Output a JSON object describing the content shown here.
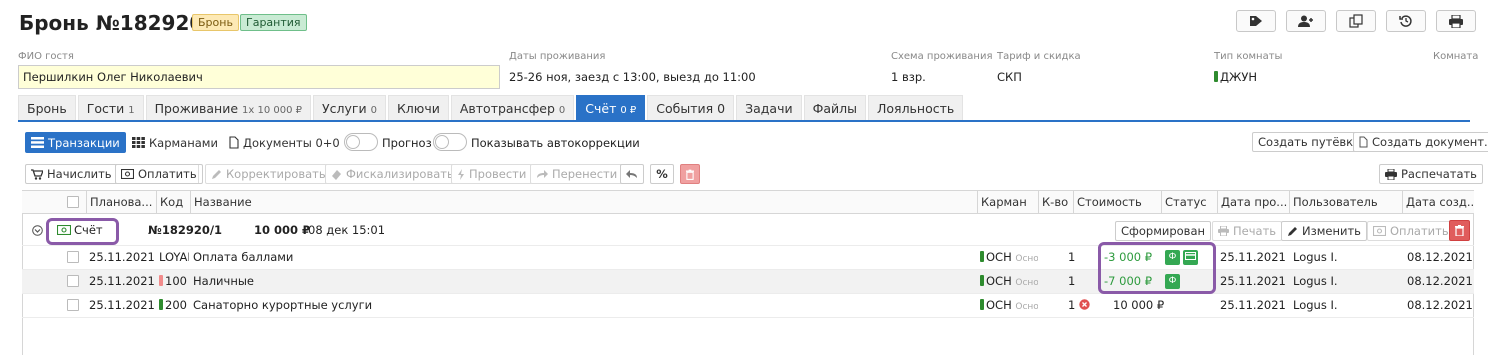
{
  "header": {
    "title": "Бронь №182920",
    "badge_status": "Бронь",
    "badge_guarantee": "Гарантия",
    "toolbar_icons": [
      "tag-icon",
      "add-user-icon",
      "copy-icon",
      "history-icon",
      "print-icon"
    ]
  },
  "info": {
    "guest_label": "ФИО гостя",
    "guest_value": "Першилкин Олег Николаевич",
    "dates_label": "Даты проживания",
    "dates_value": "25-26 ноя, заезд с 13:00, выезд до 11:00",
    "scheme_label": "Схема проживания",
    "scheme_value": "1 взр.",
    "tariff_label": "Тариф и скидка",
    "tariff_value": "СКП",
    "room_type_label": "Тип комнаты",
    "room_type_value": "ДЖУН",
    "room_label": "Комната"
  },
  "tabs": [
    {
      "label": "Бронь",
      "sub": ""
    },
    {
      "label": "Гости",
      "sub": "1"
    },
    {
      "label": "Проживание",
      "sub": "1x 10 000 ₽"
    },
    {
      "label": "Услуги",
      "sub": "0"
    },
    {
      "label": "Ключи",
      "sub": ""
    },
    {
      "label": "Автотрансфер",
      "sub": "0"
    },
    {
      "label": "Счёт",
      "sub": "0 ₽"
    },
    {
      "label": "События 0",
      "sub": ""
    },
    {
      "label": "Задачи",
      "sub": ""
    },
    {
      "label": "Файлы",
      "sub": ""
    },
    {
      "label": "Лояльность",
      "sub": ""
    }
  ],
  "view": {
    "transactions": "Транзакции",
    "pockets": "Карманами",
    "documents": "Документы 0+0",
    "forecast": "Прогноз",
    "autocorrections": "Показывать автокоррекции",
    "create_voucher": "Создать путёвки",
    "create_document": "Создать документ..."
  },
  "actions": {
    "charge": "Начислить",
    "pay": "Оплатить",
    "correct": "Корректировать",
    "fiscalize": "Фискализировать",
    "post": "Провести",
    "transfer": "Перенести",
    "percent": "%",
    "print": "Распечатать"
  },
  "columns": {
    "planned": "Планова...",
    "code": "Код",
    "name": "Название",
    "pocket": "Карман",
    "qty": "К-во",
    "cost": "Стоимость",
    "status": "Статус",
    "date_posted": "Дата про...",
    "user": "Пользователь",
    "date_created": "Дата созд..."
  },
  "invoice": {
    "label": "Счёт",
    "number": "№182920/1",
    "amount": "10 000 ₽",
    "date": "08 дек 15:01",
    "formed": "Сформирован",
    "print": "Печать",
    "edit": "Изменить",
    "pay": "Оплатить"
  },
  "rows": [
    {
      "planned": "25.11.2021",
      "code": "LOYAL",
      "name": "Оплата баллами",
      "pocket": "ОСН",
      "pocket_sub": "Осно",
      "qty": "1",
      "cost": "-3 000 ₽",
      "date_posted": "25.11.2021",
      "user": "Logus I.",
      "date_created": "08.12.2021"
    },
    {
      "planned": "25.11.2021",
      "code": "100",
      "name": "Наличные",
      "pocket": "ОСН",
      "pocket_sub": "Осно",
      "qty": "1",
      "cost": "-7 000 ₽",
      "date_posted": "25.11.2021",
      "user": "Logus I.",
      "date_created": "08.12.2021"
    },
    {
      "planned": "25.11.2021",
      "code": "200",
      "name": "Санаторно курортные услуги",
      "pocket": "ОСН",
      "pocket_sub": "Осно",
      "qty": "1",
      "cost": "10 000 ₽",
      "date_posted": "25.11.2021",
      "user": "Logus I.",
      "date_created": "08.12.2021"
    }
  ],
  "fiscal_mark": "Ф",
  "colors": {
    "accent": "#2a72c7",
    "green": "#34a853",
    "highlight": "#8a5aa8",
    "negative": "#2e9b3e"
  }
}
